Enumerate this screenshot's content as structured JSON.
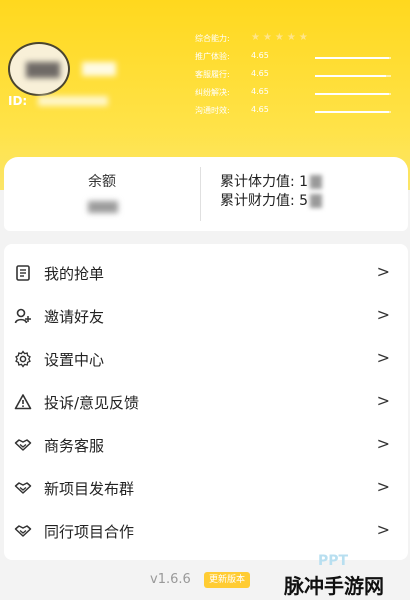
{
  "profile": {
    "id_label": "ID:"
  },
  "stats": {
    "title": "综合能力:",
    "items": [
      {
        "label": "推广体验:",
        "value": "4.65",
        "level": 0.97
      },
      {
        "label": "客服履行:",
        "value": "4.65",
        "level": 0.93
      },
      {
        "label": "纠纷解决:",
        "value": "4.65",
        "level": 0.97
      },
      {
        "label": "沟通时效:",
        "value": "4.65",
        "level": 0.97
      }
    ],
    "star_count": 5
  },
  "balance": {
    "label": "余额",
    "stamina_label": "累计体力值:",
    "stamina_visible": "1",
    "wealth_label": "累计财力值:",
    "wealth_visible": "5"
  },
  "menu": {
    "items": [
      {
        "label": "我的抢单",
        "icon": "order-list-icon"
      },
      {
        "label": "邀请好友",
        "icon": "add-user-icon"
      },
      {
        "label": "设置中心",
        "icon": "gear-icon"
      },
      {
        "label": "投诉/意见反馈",
        "icon": "warning-icon"
      },
      {
        "label": "商务客服",
        "icon": "handshake-icon"
      },
      {
        "label": "新项目发布群",
        "icon": "handshake-icon"
      },
      {
        "label": "同行项目合作",
        "icon": "handshake-icon"
      }
    ],
    "chevron": ">"
  },
  "footer": {
    "version": "v1.6.6",
    "update_label": "更新版本"
  },
  "watermark": {
    "text": "脉冲手游网"
  },
  "colors": {
    "header_yellow": "#ffd81e",
    "badge_yellow": "#ffcc33"
  }
}
